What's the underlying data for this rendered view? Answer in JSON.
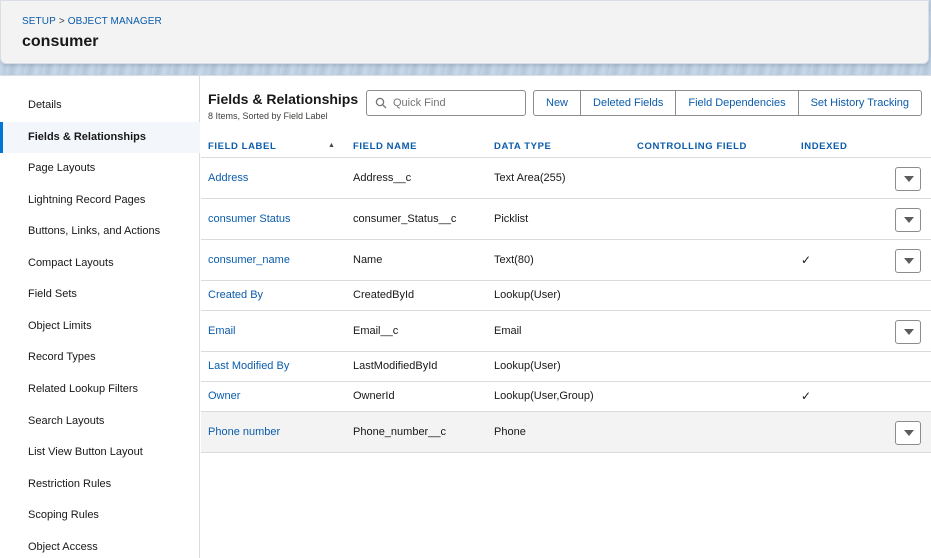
{
  "breadcrumb": {
    "setup": "SETUP",
    "separator": ">",
    "object_manager": "OBJECT MANAGER"
  },
  "page_title": "consumer",
  "sidebar": {
    "items": [
      {
        "label": "Details"
      },
      {
        "label": "Fields & Relationships",
        "active": true
      },
      {
        "label": "Page Layouts"
      },
      {
        "label": "Lightning Record Pages"
      },
      {
        "label": "Buttons, Links, and Actions"
      },
      {
        "label": "Compact Layouts"
      },
      {
        "label": "Field Sets"
      },
      {
        "label": "Object Limits"
      },
      {
        "label": "Record Types"
      },
      {
        "label": "Related Lookup Filters"
      },
      {
        "label": "Search Layouts"
      },
      {
        "label": "List View Button Layout"
      },
      {
        "label": "Restriction Rules"
      },
      {
        "label": "Scoping Rules"
      },
      {
        "label": "Object Access"
      }
    ]
  },
  "section": {
    "title": "Fields & Relationships",
    "subtitle": "8 Items, Sorted by Field Label"
  },
  "search": {
    "placeholder": "Quick Find",
    "value": ""
  },
  "toolbar": {
    "new": "New",
    "deleted_fields": "Deleted Fields",
    "field_dependencies": "Field Dependencies",
    "set_history_tracking": "Set History Tracking"
  },
  "table": {
    "columns": {
      "field_label": "FIELD LABEL",
      "field_name": "FIELD NAME",
      "data_type": "DATA TYPE",
      "controlling_field": "CONTROLLING FIELD",
      "indexed": "INDEXED"
    },
    "rows": [
      {
        "label": "Address",
        "name": "Address__c",
        "type": "Text Area(255)",
        "controlling": "",
        "indexed": false,
        "menu": true
      },
      {
        "label": "consumer Status",
        "name": "consumer_Status__c",
        "type": "Picklist",
        "controlling": "",
        "indexed": false,
        "menu": true
      },
      {
        "label": "consumer_name",
        "name": "Name",
        "type": "Text(80)",
        "controlling": "",
        "indexed": true,
        "menu": true
      },
      {
        "label": "Created By",
        "name": "CreatedById",
        "type": "Lookup(User)",
        "controlling": "",
        "indexed": false,
        "menu": false
      },
      {
        "label": "Email",
        "name": "Email__c",
        "type": "Email",
        "controlling": "",
        "indexed": false,
        "menu": true
      },
      {
        "label": "Last Modified By",
        "name": "LastModifiedById",
        "type": "Lookup(User)",
        "controlling": "",
        "indexed": false,
        "menu": false
      },
      {
        "label": "Owner",
        "name": "OwnerId",
        "type": "Lookup(User,Group)",
        "controlling": "",
        "indexed": true,
        "menu": false
      },
      {
        "label": "Phone number",
        "name": "Phone_number__c",
        "type": "Phone",
        "controlling": "",
        "indexed": false,
        "menu": true,
        "highlighted": true
      }
    ],
    "check_glyph": "✓",
    "sort_indicator": "▲"
  },
  "colors": {
    "link": "#0b5cab",
    "active_border": "#0176d3"
  }
}
